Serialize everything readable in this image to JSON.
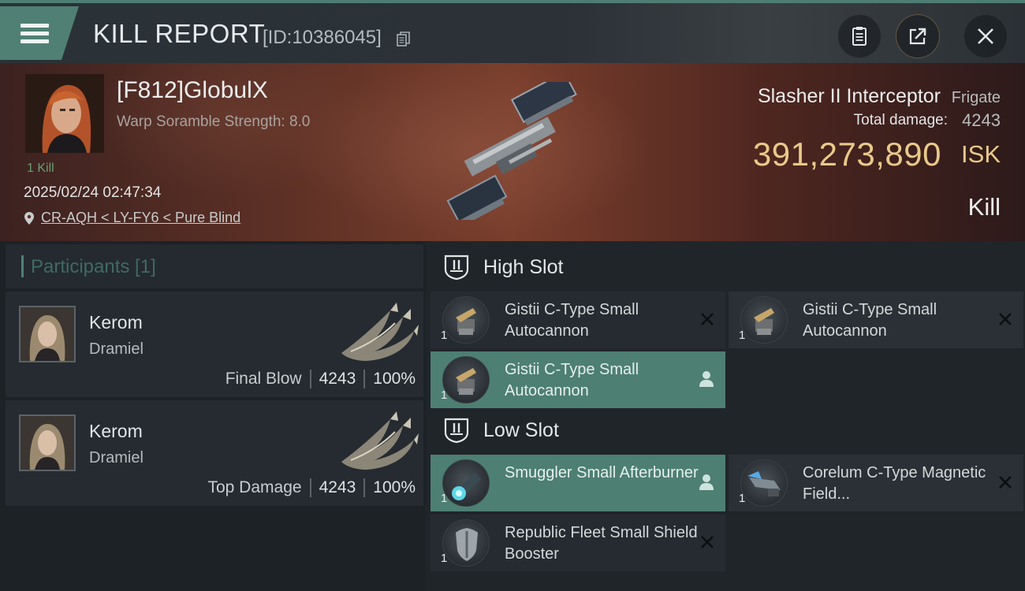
{
  "header": {
    "title": "KILL REPORT",
    "report_id": "[ID:10386045]",
    "icons": [
      "menu-icon",
      "copy-icon",
      "clipboard-icon",
      "share-icon",
      "close-icon"
    ]
  },
  "victim": {
    "pilot_name": "[F812]GlobulX",
    "scramble": "Warp Soramble Strength: 8.0",
    "kills": "1 Kill",
    "datetime": "2025/02/24 02:47:34",
    "location": "CR-AQH < LY-FY6 < Pure Blind",
    "ship_name": "Slasher II Interceptor",
    "ship_class": "Frigate",
    "total_damage_label": "Total damage:",
    "total_damage_value": "4243",
    "isk_value": "391,273,890",
    "isk_unit": "ISK",
    "result": "Kill"
  },
  "participants": {
    "heading": "Participants [1]",
    "items": [
      {
        "name": "Kerom",
        "corp": "Dramiel",
        "tag": "Final Blow",
        "damage": "4243",
        "percent": "100%"
      },
      {
        "name": "Kerom",
        "corp": "Dramiel",
        "tag": "Top Damage",
        "damage": "4243",
        "percent": "100%"
      }
    ]
  },
  "slots": {
    "high": {
      "title": "High Slot",
      "modules": [
        {
          "name": "Gistii C-Type Small Autocannon",
          "qty": "1",
          "status": "destroyed"
        },
        {
          "name": "Gistii C-Type Small Autocannon",
          "qty": "1",
          "status": "destroyed"
        },
        {
          "name": "Gistii C-Type Small Autocannon",
          "qty": "1",
          "status": "dropped"
        }
      ]
    },
    "low": {
      "title": "Low Slot",
      "modules": [
        {
          "name": "Smuggler Small Afterburner",
          "qty": "1",
          "status": "dropped"
        },
        {
          "name": "Corelum C-Type Magnetic Field...",
          "qty": "1",
          "status": "destroyed"
        },
        {
          "name": "Republic Fleet Small Shield Booster",
          "qty": "1",
          "status": "destroyed"
        }
      ]
    }
  },
  "colors": {
    "accent": "#4f8073",
    "isk": "#e9c98a",
    "kills": "#6b9c76"
  }
}
